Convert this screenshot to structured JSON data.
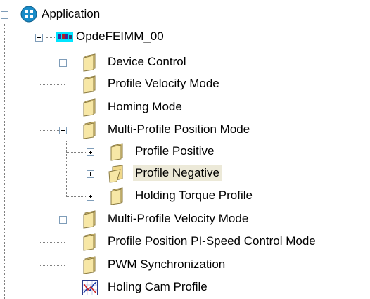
{
  "tree": {
    "root": {
      "label": "Application",
      "icon": "application-icon",
      "state": "expanded"
    },
    "device": {
      "label": "OpdeFEIMM_00",
      "icon": "device-icon",
      "state": "expanded"
    },
    "items": [
      {
        "label": "Device Control",
        "icon": "folder-closed-icon",
        "state": "collapsed"
      },
      {
        "label": "Profile Velocity Mode",
        "icon": "folder-closed-icon",
        "state": "leaf"
      },
      {
        "label": "Homing Mode",
        "icon": "folder-closed-icon",
        "state": "leaf"
      },
      {
        "label": "Multi-Profile Position Mode",
        "icon": "folder-closed-icon",
        "state": "expanded",
        "children": [
          {
            "label": "Profile Positive",
            "icon": "folder-closed-icon",
            "state": "collapsed"
          },
          {
            "label": "Profile Negative",
            "icon": "folder-open-icon",
            "state": "collapsed",
            "selected": true
          },
          {
            "label": "Holding Torque Profile",
            "icon": "folder-closed-icon",
            "state": "collapsed"
          }
        ]
      },
      {
        "label": "Multi-Profile Velocity Mode",
        "icon": "folder-closed-icon",
        "state": "collapsed"
      },
      {
        "label": "Profile Position PI-Speed Control Mode",
        "icon": "folder-closed-icon",
        "state": "leaf"
      },
      {
        "label": "PWM Synchronization",
        "icon": "folder-closed-icon",
        "state": "leaf"
      },
      {
        "label": "Holing Cam Profile",
        "icon": "chart-icon",
        "state": "leaf"
      }
    ]
  },
  "colors": {
    "selection": "#ece9d8",
    "folder": "#f0d88a",
    "application_icon": "#1a8cc8"
  }
}
